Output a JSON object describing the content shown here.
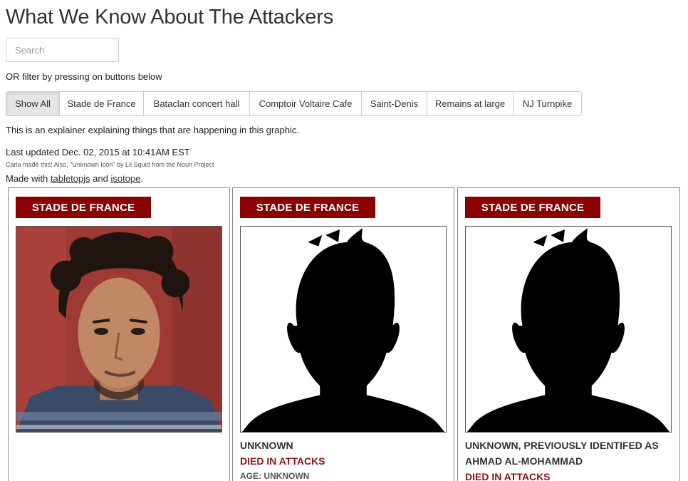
{
  "page": {
    "title": "What We Know About The Attackers",
    "search_placeholder": "Search",
    "filter_hint": "OR filter by pressing on buttons below",
    "filters": [
      {
        "label": "Show All",
        "active": true
      },
      {
        "label": "Stade de France",
        "active": false
      },
      {
        "label": "Bataclan concert hall",
        "active": false
      },
      {
        "label": "Comptoir Voltaire Cafe",
        "active": false
      },
      {
        "label": "Saint-Denis",
        "active": false
      },
      {
        "label": "Remains at large",
        "active": false
      },
      {
        "label": "NJ Turnpike",
        "active": false
      }
    ],
    "explainer": "This is an explainer explaining things that are happening in this graphic.",
    "last_updated": "Last updated Dec. 02, 2015 at 10:41AM EST",
    "credits": "Carla made this! Also, \"Unknown Icon\" by Lil Squid from the Noun Project",
    "made_with": {
      "prefix": "Made with ",
      "link1": "tabletopjs",
      "middle": " and ",
      "link2": "isotope",
      "suffix": "."
    }
  },
  "cards": [
    {
      "tag": "STADE DE FRANCE",
      "image": "portrait-photo",
      "name": "",
      "status": "",
      "age_label": "",
      "age_value": ""
    },
    {
      "tag": "STADE DE FRANCE",
      "image": "unknown-silhouette-icon",
      "name": "UNKNOWN",
      "status": "Died in attacks",
      "age_label": "Age:",
      "age_value": "Unknown"
    },
    {
      "tag": "STADE DE FRANCE",
      "image": "unknown-silhouette-icon",
      "name": "UNKNOWN, PREVIOUSLY IDENTIFED AS AHMAD AL-MOHAMMAD",
      "status": "Died in attacks",
      "age_label": "",
      "age_value": ""
    }
  ],
  "colors": {
    "tag_bg": "#8b0000",
    "status_text": "#8b1414",
    "active_button_bg": "#e6e6e6"
  }
}
